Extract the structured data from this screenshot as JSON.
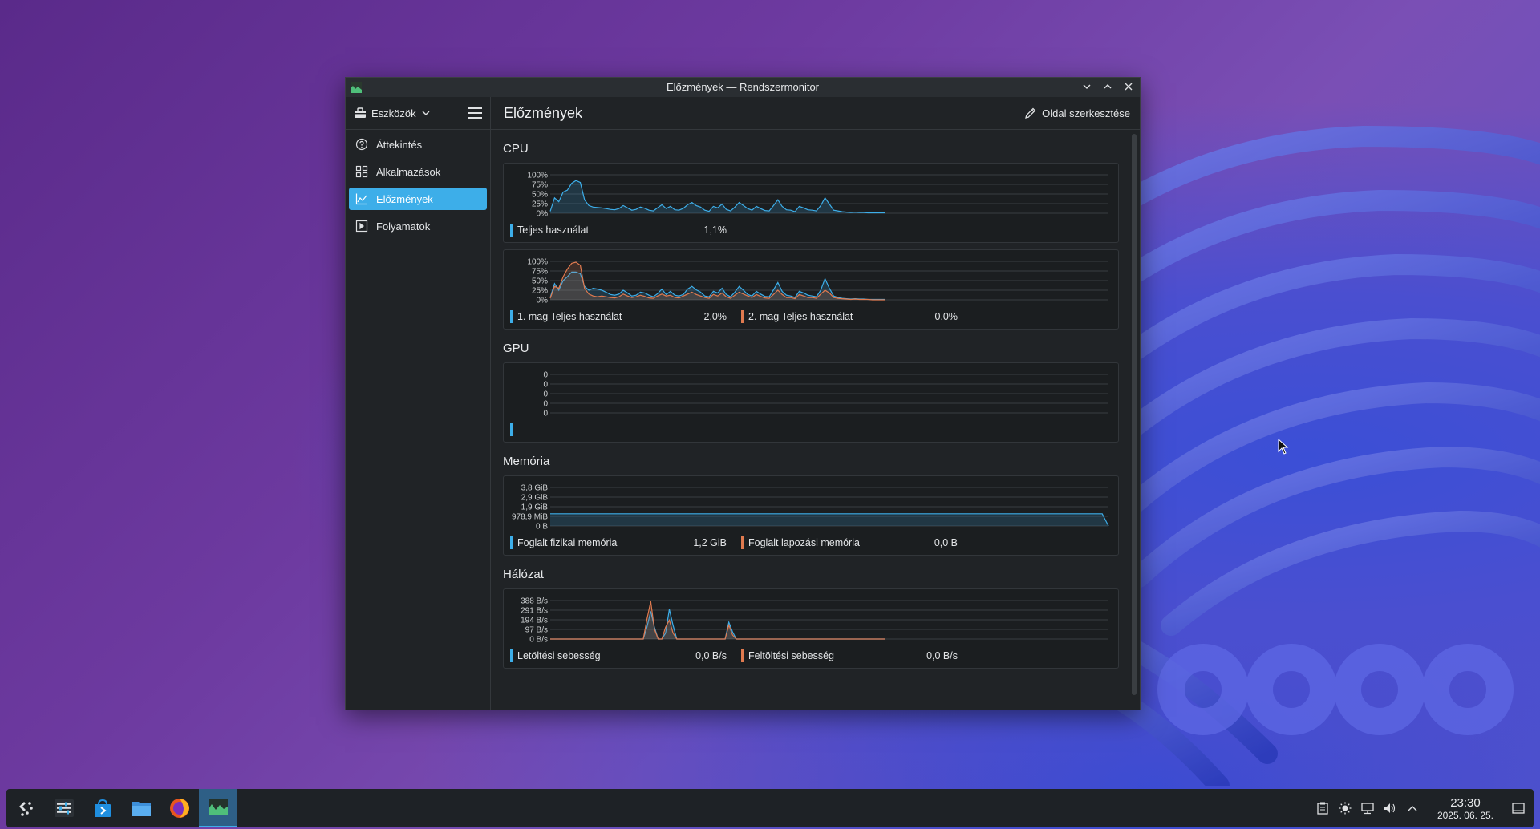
{
  "window": {
    "title": "Előzmények — Rendszermonitor",
    "controls": [
      "minimize",
      "maximize",
      "close"
    ]
  },
  "sidebar": {
    "tools_label": "Eszközök",
    "items": [
      {
        "label": "Áttekintés",
        "icon": "help-circle-icon",
        "active": false
      },
      {
        "label": "Alkalmazások",
        "icon": "grid-icon",
        "active": false
      },
      {
        "label": "Előzmények",
        "icon": "chart-line-icon",
        "active": true
      },
      {
        "label": "Folyamatok",
        "icon": "terminal-icon",
        "active": false
      }
    ]
  },
  "header": {
    "page_title": "Előzmények",
    "edit_label": "Oldal szerkesztése"
  },
  "sections": {
    "cpu_title": "CPU",
    "gpu_title": "GPU",
    "memory_title": "Memória",
    "network_title": "Hálózat"
  },
  "colors": {
    "accent": "#3daee9",
    "series_blue": "#3daee9",
    "series_orange": "#e07a4f"
  },
  "chart_data": [
    {
      "id": "cpu_total",
      "type": "area",
      "yticks": [
        "100%",
        "75%",
        "50%",
        "25%",
        "0%"
      ],
      "ylim": [
        0,
        100
      ],
      "series": [
        {
          "name": "Teljes használat",
          "value_label": "1,1%",
          "color": "#3daee9",
          "values": [
            5,
            40,
            30,
            55,
            60,
            78,
            85,
            80,
            35,
            20,
            16,
            15,
            14,
            12,
            10,
            9,
            12,
            20,
            14,
            8,
            10,
            16,
            13,
            8,
            6,
            14,
            22,
            12,
            18,
            9,
            8,
            13,
            22,
            28,
            20,
            16,
            8,
            5,
            18,
            14,
            24,
            10,
            6,
            16,
            28,
            20,
            12,
            8,
            18,
            12,
            7,
            6,
            20,
            35,
            18,
            9,
            8,
            4,
            18,
            14,
            9,
            8,
            6,
            20,
            40,
            24,
            8,
            6,
            4,
            3,
            2,
            3,
            2,
            2,
            1,
            1,
            1,
            1,
            1
          ]
        }
      ]
    },
    {
      "id": "cpu_cores",
      "type": "area",
      "yticks": [
        "100%",
        "75%",
        "50%",
        "25%",
        "0%"
      ],
      "ylim": [
        0,
        100
      ],
      "series": [
        {
          "name": "1. mag Teljes használat",
          "value_label": "2,0%",
          "color": "#3daee9",
          "values": [
            6,
            42,
            25,
            50,
            60,
            72,
            72,
            68,
            35,
            25,
            30,
            28,
            25,
            20,
            14,
            12,
            15,
            25,
            18,
            10,
            12,
            20,
            18,
            12,
            8,
            16,
            28,
            14,
            22,
            12,
            10,
            14,
            28,
            35,
            26,
            20,
            10,
            8,
            22,
            18,
            30,
            14,
            8,
            20,
            35,
            25,
            14,
            10,
            22,
            15,
            9,
            8,
            26,
            45,
            22,
            12,
            10,
            6,
            22,
            18,
            12,
            10,
            8,
            25,
            55,
            30,
            10,
            6,
            4,
            3,
            2,
            3,
            2,
            2,
            1,
            1,
            1,
            1,
            1
          ]
        },
        {
          "name": "2. mag Teljes használat",
          "value_label": "0,0%",
          "color": "#e07a4f",
          "values": [
            4,
            35,
            30,
            60,
            80,
            95,
            98,
            90,
            30,
            15,
            10,
            8,
            10,
            8,
            6,
            5,
            8,
            15,
            10,
            6,
            8,
            12,
            9,
            5,
            4,
            10,
            15,
            10,
            12,
            6,
            5,
            10,
            15,
            20,
            14,
            10,
            6,
            4,
            14,
            10,
            18,
            8,
            4,
            12,
            20,
            15,
            10,
            6,
            14,
            9,
            5,
            4,
            14,
            25,
            14,
            6,
            6,
            3,
            14,
            10,
            6,
            6,
            4,
            15,
            25,
            18,
            6,
            4,
            3,
            2,
            1,
            2,
            1,
            1,
            1,
            0,
            0,
            0,
            0
          ]
        }
      ]
    },
    {
      "id": "gpu",
      "type": "line",
      "yticks": [
        "0",
        "0",
        "0",
        "0",
        "0"
      ],
      "ylim": [
        0,
        1
      ],
      "series": [
        {
          "name": "",
          "value_label": "",
          "color": "#3daee9",
          "values": []
        }
      ]
    },
    {
      "id": "memory",
      "type": "area",
      "yticks": [
        "3,8 GiB",
        "2,9 GiB",
        "1,9 GiB",
        "978,9 MiB",
        "0 B"
      ],
      "ylim": [
        0,
        3.8
      ],
      "series": [
        {
          "name": "Foglalt fizikai memória",
          "value_label": "1,2 GiB",
          "color": "#3daee9",
          "values": [
            1.2,
            1.2,
            1.2,
            1.2,
            1.2,
            1.2,
            1.2,
            1.2,
            1.2,
            1.2,
            1.2,
            1.2,
            1.2,
            1.2,
            1.2,
            1.2,
            1.2,
            1.2,
            1.2,
            1.2,
            1.2,
            1.2,
            1.2,
            1.2,
            1.2,
            1.2,
            1.2,
            1.2,
            1.2,
            1.2,
            1.2,
            1.2,
            1.2,
            1.2,
            1.2,
            1.2,
            1.2,
            1.2,
            1.2,
            1.2,
            1.2,
            1.2,
            1.2,
            1.2,
            1.2,
            1.2,
            1.2,
            1.2,
            1.2,
            1.2,
            1.2,
            1.2,
            1.2,
            1.2,
            1.2,
            1.2,
            1.2,
            1.2,
            1.2,
            1.2,
            1.2,
            1.2,
            1.2,
            1.2,
            1.2,
            1.2,
            1.2,
            1.2,
            1.2,
            1.2,
            1.2,
            1.2,
            1.2,
            1.2,
            1.2,
            1.2,
            1.2,
            1.2,
            1.2,
            1.2,
            1.2,
            1.2,
            1.2,
            1.2,
            1.2,
            1.2,
            1.2,
            1.2,
            1.2,
            0
          ]
        },
        {
          "name": "Foglalt lapozási memória",
          "value_label": "0,0 B",
          "color": "#e07a4f",
          "values": []
        }
      ]
    },
    {
      "id": "network",
      "type": "area",
      "yticks": [
        "388 B/s",
        "291 B/s",
        "194 B/s",
        "97 B/s",
        "0 B/s"
      ],
      "ylim": [
        0,
        388
      ],
      "series": [
        {
          "name": "Letöltési sebesség",
          "value_label": "0,0 B/s",
          "color": "#3daee9",
          "values": [
            0,
            0,
            0,
            0,
            0,
            0,
            0,
            0,
            0,
            0,
            0,
            0,
            0,
            0,
            0,
            0,
            0,
            0,
            0,
            0,
            0,
            0,
            0,
            0,
            0,
            0,
            120,
            280,
            120,
            0,
            0,
            60,
            300,
            140,
            0,
            0,
            0,
            0,
            0,
            0,
            0,
            0,
            0,
            0,
            0,
            0,
            0,
            0,
            170,
            70,
            0,
            0,
            0,
            0,
            0,
            0,
            0,
            0,
            0,
            0,
            0,
            0,
            0,
            0,
            0,
            0,
            0,
            0,
            0,
            0,
            0,
            0,
            0,
            0,
            0,
            0,
            0,
            0,
            0,
            0,
            0,
            0,
            0,
            0,
            0,
            0,
            0,
            0,
            0,
            0,
            0
          ]
        },
        {
          "name": "Feltöltési sebesség",
          "value_label": "0,0 B/s",
          "color": "#e07a4f",
          "values": [
            0,
            0,
            0,
            0,
            0,
            0,
            0,
            0,
            0,
            0,
            0,
            0,
            0,
            0,
            0,
            0,
            0,
            0,
            0,
            0,
            0,
            0,
            0,
            0,
            0,
            0,
            200,
            380,
            100,
            0,
            0,
            120,
            190,
            60,
            0,
            0,
            0,
            0,
            0,
            0,
            0,
            0,
            0,
            0,
            0,
            0,
            0,
            0,
            140,
            40,
            0,
            0,
            0,
            0,
            0,
            0,
            0,
            0,
            0,
            0,
            0,
            0,
            0,
            0,
            0,
            0,
            0,
            0,
            0,
            0,
            0,
            0,
            0,
            0,
            0,
            0,
            0,
            0,
            0,
            0,
            0,
            0,
            0,
            0,
            0,
            0,
            0,
            0,
            0,
            0,
            0
          ]
        }
      ]
    }
  ],
  "taskbar": {
    "items": [
      {
        "name": "app-launcher-icon",
        "active": false
      },
      {
        "name": "system-settings-icon",
        "active": false
      },
      {
        "name": "discover-store-icon",
        "active": false
      },
      {
        "name": "file-manager-icon",
        "active": false
      },
      {
        "name": "firefox-icon",
        "active": false
      },
      {
        "name": "system-monitor-icon",
        "active": true
      }
    ],
    "clock_time": "23:30",
    "clock_date": "2025. 06. 25."
  }
}
